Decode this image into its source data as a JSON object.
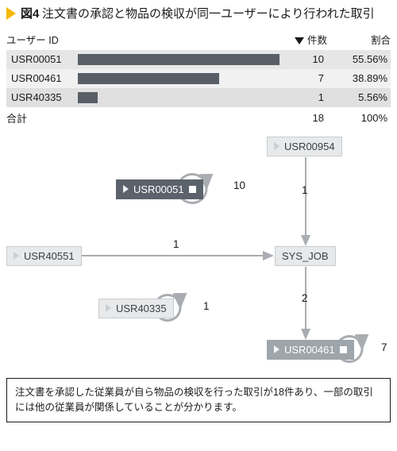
{
  "figure": {
    "label": "図4",
    "caption": "注文書の承認と物品の検収が同一ユーザーにより行われた取引"
  },
  "table": {
    "headers": {
      "user": "ユーザー ID",
      "count": "件数",
      "ratio": "割合"
    },
    "rows": [
      {
        "user": "USR00051",
        "count": "10",
        "ratio": "55.56%",
        "bar_pct": 100
      },
      {
        "user": "USR00461",
        "count": "7",
        "ratio": "38.89%",
        "bar_pct": 70
      },
      {
        "user": "USR40335",
        "count": "1",
        "ratio": "5.56%",
        "bar_pct": 10
      }
    ],
    "total": {
      "label": "合計",
      "count": "18",
      "ratio": "100%"
    }
  },
  "diagram": {
    "nodes": {
      "n_usr00954": {
        "label": "USR00954"
      },
      "n_usr00051": {
        "label": "USR00051"
      },
      "n_usr40551": {
        "label": "USR40551"
      },
      "n_sysjob": {
        "label": "SYS_JOB"
      },
      "n_usr40335": {
        "label": "USR40335"
      },
      "n_usr00461": {
        "label": "USR00461"
      }
    },
    "edges": {
      "e_00051_self": "10",
      "e_00954_sys": "1",
      "e_40551_sys": "1",
      "e_sys_00461": "2",
      "e_40335_self": "1",
      "e_00461_self": "7"
    }
  },
  "chart_data": {
    "type": "bar",
    "title": "注文書の承認と物品の検収が同一ユーザーにより行われた取引",
    "categories": [
      "USR00051",
      "USR00461",
      "USR40335"
    ],
    "series": [
      {
        "name": "件数",
        "values": [
          10,
          7,
          1
        ]
      },
      {
        "name": "割合(%)",
        "values": [
          55.56,
          38.89,
          5.56
        ]
      }
    ],
    "total": {
      "count": 18,
      "ratio_pct": 100
    },
    "xlabel": "",
    "ylabel": "件数"
  },
  "footer_caption": "注文書を承認した従業員が自ら物品の検収を行った取引が18件あり、一部の取引には他の従業員が関係していることが分かります。"
}
